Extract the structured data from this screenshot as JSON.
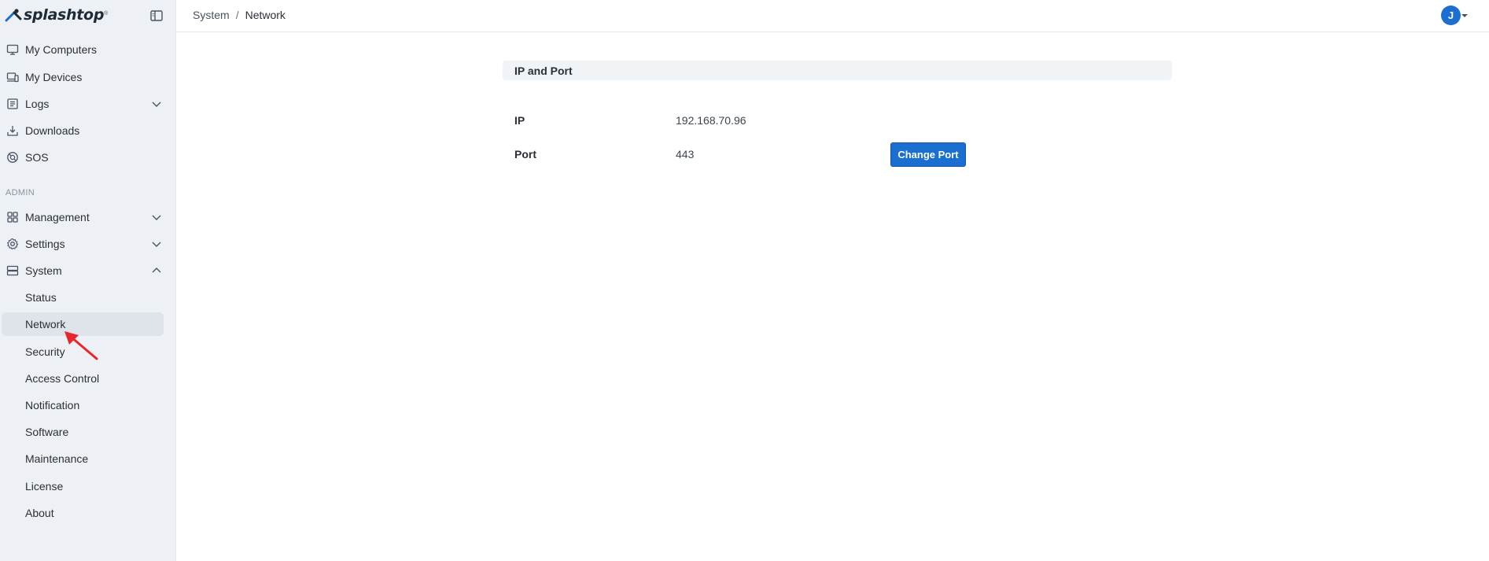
{
  "brand": {
    "name": "splashtop",
    "registered": "®"
  },
  "sidebar": {
    "items": [
      {
        "label": "My Computers",
        "icon": "monitor-icon"
      },
      {
        "label": "My Devices",
        "icon": "devices-icon"
      },
      {
        "label": "Logs",
        "icon": "logs-icon"
      },
      {
        "label": "Downloads",
        "icon": "download-icon"
      },
      {
        "label": "SOS",
        "icon": "sos-icon"
      }
    ],
    "admin_label": "ADMIN",
    "admin_items": [
      {
        "label": "Management",
        "icon": "grid-icon"
      },
      {
        "label": "Settings",
        "icon": "gear-icon"
      },
      {
        "label": "System",
        "icon": "server-icon"
      }
    ],
    "system_sub_items": [
      {
        "label": "Status"
      },
      {
        "label": "Network"
      },
      {
        "label": "Security"
      },
      {
        "label": "Access Control"
      },
      {
        "label": "Notification"
      },
      {
        "label": "Software"
      },
      {
        "label": "Maintenance"
      },
      {
        "label": "License"
      },
      {
        "label": "About"
      }
    ],
    "active_item": "Network"
  },
  "breadcrumb": {
    "parent": "System",
    "separator": "/",
    "current": "Network"
  },
  "user": {
    "initial": "J"
  },
  "panel": {
    "title": "IP and Port",
    "rows": [
      {
        "label": "IP",
        "value": "192.168.70.96"
      },
      {
        "label": "Port",
        "value": "443"
      }
    ],
    "change_port_label": "Change Port"
  },
  "colors": {
    "accent": "#1a6fd1",
    "sidebar_bg": "#edf1f5",
    "annotation": "#e8262b"
  }
}
